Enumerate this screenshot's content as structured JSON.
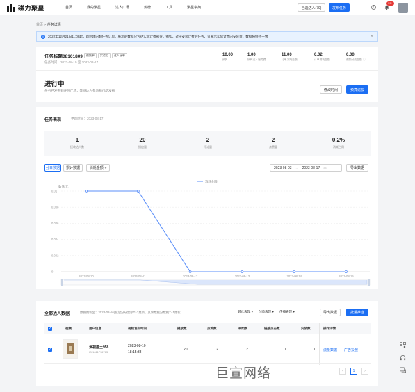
{
  "brand": {
    "name": "磁力聚星"
  },
  "nav": [
    "首页",
    "我的聚星",
    "达人广场",
    "热榜",
    "工具",
    "聚星学苑"
  ],
  "topbar": {
    "selected_btn": "已选达人(79)",
    "publish_btn": "发布任务",
    "badge": "99+"
  },
  "breadcrumb": {
    "root": "首页",
    "sep": ">",
    "current": "任务详情"
  },
  "notice": {
    "text": "2022年12月21日11:08起，新创建的翻任务订单，展示的数据只包括实际计费部分，例如，对于安装计费的任务，只展示实际计费的安装量，数据将保持一致"
  },
  "task": {
    "title": "任务标题08101809",
    "tags": [
      "视频单",
      "实验组",
      "达人接单"
    ],
    "time_label": "任务时间：",
    "time_range": "2023-08-10 至 2023-08-17",
    "metrics": [
      {
        "value": "10.00",
        "label": "预算"
      },
      {
        "value": "1.00",
        "label": "所有达人服务费"
      },
      {
        "value": "11.00",
        "label": "订单冻结金额"
      },
      {
        "value": "0.02",
        "label": "订单消耗金额"
      },
      {
        "value": "0.00",
        "label": "视频分成金额 ⓘ"
      }
    ]
  },
  "status": {
    "title": "进行中",
    "desc": "任务已发布到任务广场，等待达人参与和作品发布",
    "modify_btn": "修改时间",
    "predict_btn": "预算追投"
  },
  "performance": {
    "title": "任务表现",
    "update": "更新时间：2023-08-17",
    "stats": [
      {
        "value": "1",
        "label": "接收达人数"
      },
      {
        "value": "20",
        "label": "播放量"
      },
      {
        "value": "2",
        "label": "评论量"
      },
      {
        "value": "2",
        "label": "点赞量"
      },
      {
        "value": "0.2%",
        "label": "消耗占用"
      }
    ],
    "toggle": [
      "分日数据",
      "累计数据"
    ],
    "metric_select": "消耗金额",
    "date_start": "2023-08-03",
    "date_end": "2023-08-17",
    "date_sep": "→",
    "export_btn": "导出数据"
  },
  "chart_data": {
    "type": "line",
    "ylabel": "数值/元",
    "legend": "消耗金额",
    "x": [
      "2023-08-10",
      "2023-08-11",
      "2023-08-12",
      "2023-08-13",
      "2023-08-14",
      "2023-08-15"
    ],
    "y_ticks": [
      "0.01",
      "0.008",
      "0.006",
      "0.004",
      "0.002",
      "0"
    ],
    "ylim": [
      0,
      0.01
    ],
    "series": [
      {
        "name": "消耗金额",
        "values": [
          0.01,
          0.01,
          0,
          0,
          0,
          0
        ]
      }
    ],
    "color": "#5b8ff9"
  },
  "creators": {
    "title": "全部达人数据",
    "note": "数据更新至：2023-08-16(投放分成金额T+2更新，其余数据分数据T+1更新)",
    "filters": [
      "转化表现 ▾",
      "创意表现 ▾",
      "传播表现 ▾"
    ],
    "export_btn": "导出数据",
    "batch_btn": "批量推送",
    "columns": [
      "视频",
      "用户信息",
      "视频发布时间",
      "播放数",
      "点赞数",
      "评论数",
      "链接点击数",
      "安装数",
      "操作详情"
    ],
    "rows": [
      {
        "user": "演视猫土958",
        "uid": "ID:1611716763",
        "publish_date": "2023-08-10",
        "publish_time": "18:15:38",
        "plays": "20",
        "likes": "2",
        "comments": "2",
        "clicks": "0",
        "installs": "0",
        "op1": "流量数据",
        "op2": "广告投放"
      }
    ],
    "page": "1"
  },
  "watermark": "巨宣网络"
}
